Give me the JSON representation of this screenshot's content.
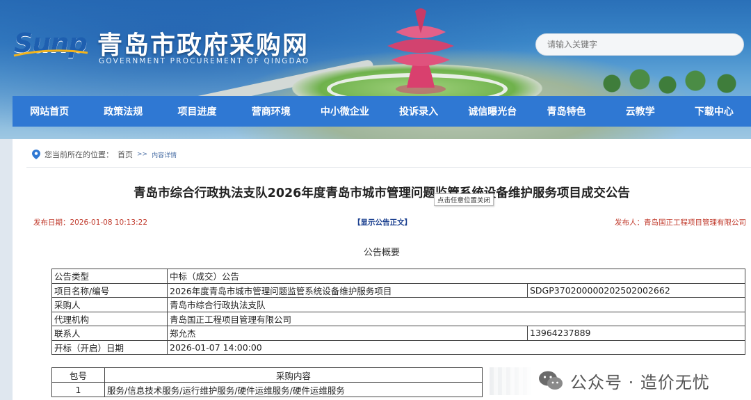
{
  "site": {
    "brand": "Sunp",
    "title": "青岛市政府采购网",
    "subtitle": "GOVERNMENT PROCUREMENT OF QINGDAO",
    "search_placeholder": "请输入关键字"
  },
  "nav": {
    "items": [
      "网站首页",
      "政策法规",
      "项目进度",
      "营商环境",
      "中小微企业",
      "投诉录入",
      "诚信曝光台",
      "青岛特色",
      "云教学",
      "下载中心"
    ]
  },
  "breadcrumb": {
    "prefix": "您当前所在的位置：",
    "home": "首页",
    "separator": ">>",
    "current": "内容详情"
  },
  "notice": {
    "title": "青岛市综合行政执法支队2026年度青岛市城市管理问题监管系统设备维护服务项目成交公告",
    "tooltip": "点击任意位置关闭",
    "publish_date": "发布日期：2026-01-08 10:13:22",
    "show_text_link": "【显示公告正文】",
    "publisher": "发布人：青岛国正工程项目管理有限公司",
    "summary_heading": "公告概要"
  },
  "info_table": {
    "type_label": "公告类型",
    "type_value": "中标（成交）公告",
    "project_label": "项目名称/编号",
    "project_name": "2026年度青岛市城市管理问题监管系统设备维护服务项目",
    "project_code": "SDGP370200000202502002662",
    "buyer_label": "采购人",
    "buyer_value": "青岛市综合行政执法支队",
    "agency_label": "代理机构",
    "agency_value": "青岛国正工程项目管理有限公司",
    "contact_label": "联系人",
    "contact_name": "郑允杰",
    "contact_phone": "13964237889",
    "open_label": "开标（开启）日期",
    "open_value": "2026-01-07 14:00:00"
  },
  "package_table": {
    "col_package": "包号",
    "col_content": "采购内容",
    "rows": [
      {
        "package": "1",
        "content": "服务/信息技术服务/运行维护服务/硬件运维服务/硬件运维服务"
      }
    ]
  },
  "watermark": {
    "text": "公众号 · 造价无忧"
  }
}
